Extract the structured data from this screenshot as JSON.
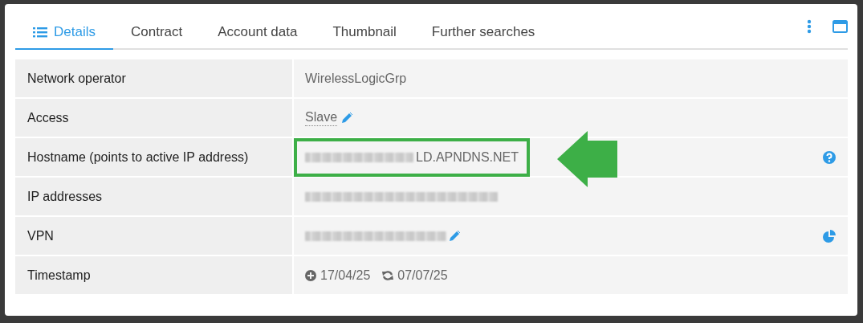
{
  "tabs": [
    {
      "label": "Details",
      "selected": true
    },
    {
      "label": "Contract",
      "selected": false
    },
    {
      "label": "Account data",
      "selected": false
    },
    {
      "label": "Thumbnail",
      "selected": false
    },
    {
      "label": "Further searches",
      "selected": false
    }
  ],
  "rows": [
    {
      "kind": "text",
      "label": "Network operator",
      "value": "WirelessLogicGrp"
    },
    {
      "kind": "editable",
      "label": "Access",
      "value": "Slave"
    },
    {
      "kind": "hostname",
      "label": "Hostname (points to active IP address)",
      "value": "LD.APNDNS.NET"
    },
    {
      "kind": "addresses",
      "label": "IP addresses"
    },
    {
      "kind": "vpn",
      "label": "VPN"
    },
    {
      "kind": "dates",
      "label": "Timestamp",
      "created": "17/04/25",
      "updated": "07/07/25"
    }
  ]
}
